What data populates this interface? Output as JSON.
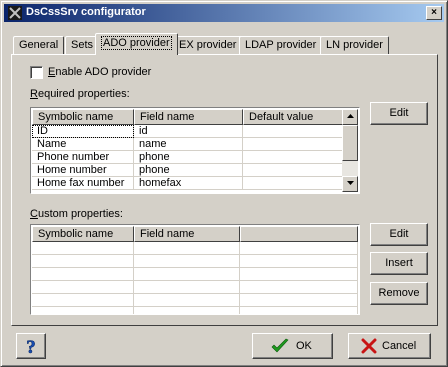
{
  "window": {
    "title": "DsCssSrv configurator",
    "close_glyph": "×"
  },
  "tabs": [
    {
      "label": "General"
    },
    {
      "label": "Sets"
    },
    {
      "label": "ADO provider"
    },
    {
      "label": "EX provider"
    },
    {
      "label": "LDAP provider"
    },
    {
      "label": "LN provider"
    }
  ],
  "active_tab": "ADO provider",
  "enable_checkbox": {
    "label_prefix": "",
    "label_u": "E",
    "label_rest": "nable ADO provider",
    "checked": false
  },
  "required": {
    "label_u": "R",
    "label_rest": "equired properties:",
    "columns": [
      "Symbolic name",
      "Field name",
      "Default value"
    ],
    "rows": [
      [
        "ID",
        "id",
        ""
      ],
      [
        "Name",
        "name",
        ""
      ],
      [
        "Phone number",
        "phone",
        ""
      ],
      [
        "Home number",
        "phone",
        ""
      ],
      [
        "Home fax number",
        "homefax",
        ""
      ]
    ],
    "edit_label": "Edit"
  },
  "custom": {
    "label_u": "C",
    "label_rest": "ustom properties:",
    "columns": [
      "Symbolic name",
      "Field name",
      ""
    ],
    "rows": [],
    "edit_label": "Edit",
    "insert_label": "Insert",
    "remove_label": "Remove"
  },
  "footer": {
    "help_glyph": "?",
    "ok_label": "OK",
    "cancel_label": "Cancel"
  },
  "icons": {
    "help": "help-icon",
    "ok": "checkmark-icon",
    "cancel": "x-icon",
    "app": "app-icon"
  },
  "colors": {
    "title_start": "#0a246a",
    "title_end": "#a6caf0",
    "face": "#d4d0c8",
    "ok_green": "#1f9a1f",
    "cancel_red": "#c81414",
    "help_blue": "#1a4fb4"
  }
}
